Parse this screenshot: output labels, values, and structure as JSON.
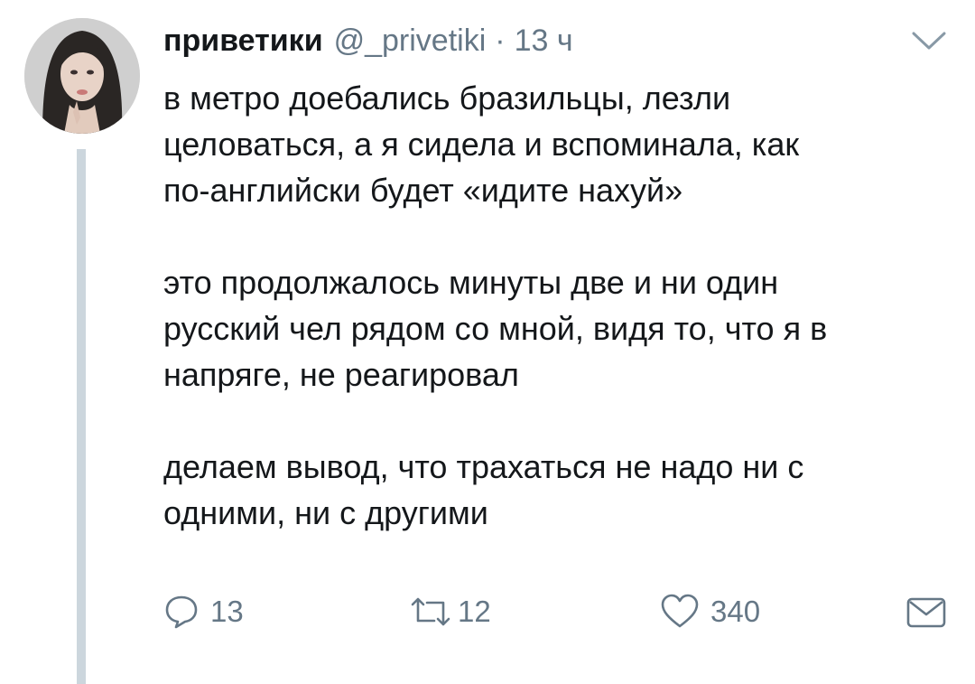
{
  "tweet": {
    "avatar_icon": "profile-photo",
    "display_name": "приветики",
    "handle": "@_privetiki",
    "separator": "·",
    "time": "13 ч",
    "menu_icon": "chevron-down-icon",
    "paragraphs": [
      "в метро доебались бразильцы, лезли\nцеловаться, а я сидела и вспоминала, как\nпо-английски будет «идите нахуй»",
      "это продолжалось минуты две и ни один\nрусский чел рядом со мной, видя то, что я в\nнапряге, не реагировал",
      "делаем вывод, что трахаться не надо ни с\nодними, ни с другими"
    ],
    "actions": {
      "reply": {
        "icon": "reply-icon",
        "count": "13"
      },
      "retweet": {
        "icon": "retweet-icon",
        "count": "12"
      },
      "like": {
        "icon": "heart-icon",
        "count": "340"
      },
      "dm": {
        "icon": "envelope-icon"
      }
    },
    "colors": {
      "text": "#14171a",
      "secondary": "#657786",
      "thread_line": "#ccd6dd"
    }
  }
}
